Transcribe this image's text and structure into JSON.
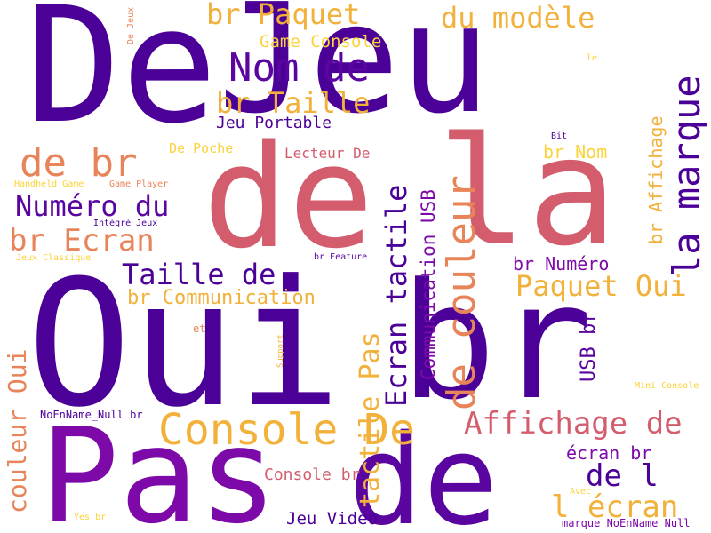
{
  "palette": [
    "#4b0098",
    "#5a05a0",
    "#7d0aa8",
    "#d35d6d",
    "#e8845a",
    "#f2b13a",
    "#fbd33a"
  ],
  "words": [
    {
      "text": "Jeu",
      "color": "#4b0098"
    },
    {
      "text": "De",
      "color": "#4b0098"
    },
    {
      "text": "la",
      "color": "#d35d6d"
    },
    {
      "text": "de",
      "color": "#d35d6d"
    },
    {
      "text": "Oui",
      "color": "#4b0098"
    },
    {
      "text": "br",
      "color": "#4b0098"
    },
    {
      "text": "Pas",
      "color": "#7d0aa8"
    },
    {
      "text": "de",
      "color": "#5a05a0"
    },
    {
      "text": "la marque",
      "color": "#4b0098"
    },
    {
      "text": "de couleur",
      "color": "#e8845a"
    },
    {
      "text": "Nom de",
      "color": "#5a05a0"
    },
    {
      "text": "br Paquet",
      "color": "#f2b13a"
    },
    {
      "text": "du modèle",
      "color": "#f2b13a"
    },
    {
      "text": "Game Console",
      "color": "#fbd33a"
    },
    {
      "text": "br Taille",
      "color": "#f2b13a"
    },
    {
      "text": "Jeu Portable",
      "color": "#4b0098"
    },
    {
      "text": "de br",
      "color": "#e8845a"
    },
    {
      "text": "Numéro du",
      "color": "#5a05a0"
    },
    {
      "text": "br Ecran",
      "color": "#e8845a"
    },
    {
      "text": "Taille de",
      "color": "#4b0098"
    },
    {
      "text": "br Communication",
      "color": "#f2b13a"
    },
    {
      "text": "Ecran tactile",
      "color": "#4b0098"
    },
    {
      "text": "Communication USB",
      "color": "#7d0aa8"
    },
    {
      "text": "tactile Pas",
      "color": "#f2b13a"
    },
    {
      "text": "br Affichage",
      "color": "#f2b13a"
    },
    {
      "text": "br Nom",
      "color": "#fbd33a"
    },
    {
      "text": "br Numéro",
      "color": "#7d0aa8"
    },
    {
      "text": "Paquet Oui",
      "color": "#f2b13a"
    },
    {
      "text": "Lecteur De",
      "color": "#d35d6d"
    },
    {
      "text": "De Poche",
      "color": "#fbd33a"
    },
    {
      "text": "Console De",
      "color": "#f2b13a"
    },
    {
      "text": "Affichage de",
      "color": "#d35d6d"
    },
    {
      "text": "couleur Oui",
      "color": "#e8845a"
    },
    {
      "text": "USB br",
      "color": "#5a05a0"
    },
    {
      "text": "écran br",
      "color": "#7d0aa8"
    },
    {
      "text": "de l",
      "color": "#4b0098"
    },
    {
      "text": "l écran",
      "color": "#f2b13a"
    },
    {
      "text": "Console br",
      "color": "#d35d6d"
    },
    {
      "text": "Jeu Vidéo",
      "color": "#4b0098"
    },
    {
      "text": "NoEnName_Null br",
      "color": "#4b0098"
    },
    {
      "text": "marque NoEnName_Null",
      "color": "#7d0aa8"
    },
    {
      "text": "Handheld Game",
      "color": "#fbd33a"
    },
    {
      "text": "Game Player",
      "color": "#e8845a"
    },
    {
      "text": "Intégré Jeux",
      "color": "#4b0098"
    },
    {
      "text": "Jeux Classique",
      "color": "#fbd33a"
    },
    {
      "text": "br Feature",
      "color": "#5a05a0"
    },
    {
      "text": "et",
      "color": "#e8845a"
    },
    {
      "text": "Support",
      "color": "#f2b13a"
    },
    {
      "text": "Mini Console",
      "color": "#fbd33a"
    },
    {
      "text": "Avec",
      "color": "#fbd33a"
    },
    {
      "text": "Yes br",
      "color": "#fbd33a"
    },
    {
      "text": "Bit",
      "color": "#4b0098"
    },
    {
      "text": "le",
      "color": "#fbd33a"
    },
    {
      "text": "De Jeux",
      "color": "#e8845a"
    }
  ]
}
